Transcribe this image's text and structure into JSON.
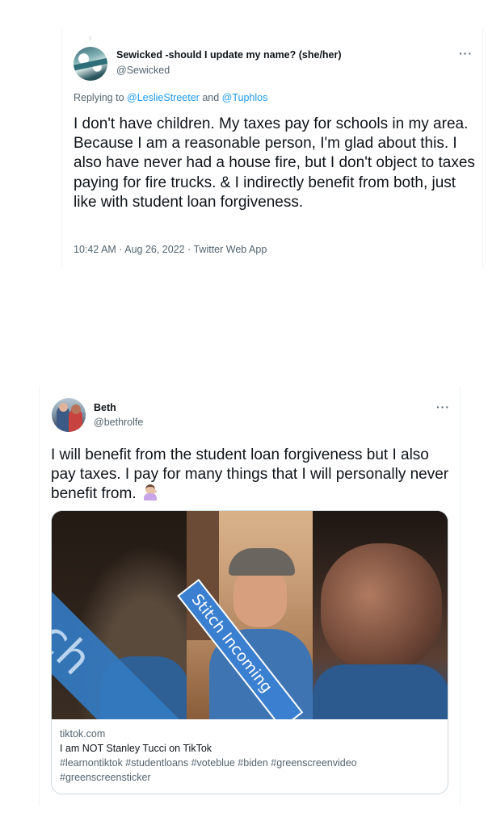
{
  "tweet1": {
    "display_name": "Sewicked -should I update my name? (she/her)",
    "handle": "@Sewicked",
    "more_label": "···",
    "replying_prefix": "Replying to ",
    "mention1": "@LeslieStreeter",
    "mention_and": " and ",
    "mention2": "@Tuphlos",
    "text": "I don't have children. My taxes pay for schools in my area. Because I am a reasonable person, I'm glad about this. I also have never had a house fire, but I don't object to taxes paying for fire trucks. & I indirectly benefit from both, just like with student loan forgiveness.",
    "timestamp": "10:42 AM · Aug 26, 2022 · Twitter Web App"
  },
  "tweet2": {
    "display_name": "Beth",
    "handle": "@bethrolfe",
    "more_label": "···",
    "text": "I will benefit from the student loan forgiveness but I also pay taxes. I pay for many things that I will personally never benefit from.",
    "emoji_icon": "woman-shrugging-icon",
    "card": {
      "overlay_left": "Stitch",
      "overlay_center": "Stitch Incoming",
      "domain": "tiktok.com",
      "title": "I am NOT Stanley Tucci on TikTok",
      "description": "#learnontiktok #studentloans #voteblue #biden #greenscreenvideo #greenscreensticker"
    }
  },
  "colors": {
    "link": "#1d9bf0",
    "secondary_text": "#536471",
    "primary_text": "#0f1419",
    "border": "#eff3f4"
  }
}
